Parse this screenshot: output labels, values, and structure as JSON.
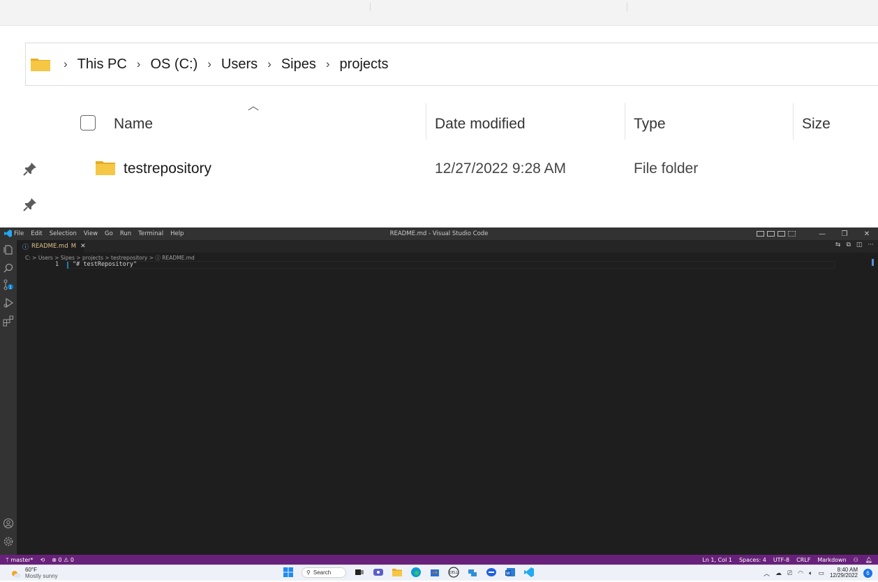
{
  "explorer": {
    "breadcrumb": [
      "This PC",
      "OS (C:)",
      "Users",
      "Sipes",
      "projects"
    ],
    "columns": {
      "name": "Name",
      "date_modified": "Date modified",
      "type": "Type",
      "size": "Size"
    },
    "rows": [
      {
        "name": "testrepository",
        "date_modified": "12/27/2022 9:28 AM",
        "type": "File folder",
        "size": ""
      }
    ]
  },
  "vscode": {
    "menu": [
      "File",
      "Edit",
      "Selection",
      "View",
      "Go",
      "Run",
      "Terminal",
      "Help"
    ],
    "window_title": "README.md - Visual Studio Code",
    "tab": {
      "label": "README.md",
      "badge": "M"
    },
    "breadcrumb": "C: > Users > Sipes > projects > testrepository > ⓘ README.md",
    "editor": {
      "line_number": "1",
      "line_text": "\"# testRepository\""
    },
    "status": {
      "branch": "master*",
      "problems": "0",
      "warnings": "0",
      "position": "Ln 1, Col 1",
      "spaces": "Spaces: 4",
      "encoding": "UTF-8",
      "eol": "CRLF",
      "language": "Markdown"
    }
  },
  "taskbar": {
    "weather_temp": "60°F",
    "weather_desc": "Mostly sunny",
    "search_label": "Search",
    "time": "8:40 AM",
    "date": "12/29/2022",
    "notification_count": "6"
  },
  "colors": {
    "folder": "#f4c542",
    "status_bar": "#68217a",
    "vscode_blue": "#007acc"
  }
}
